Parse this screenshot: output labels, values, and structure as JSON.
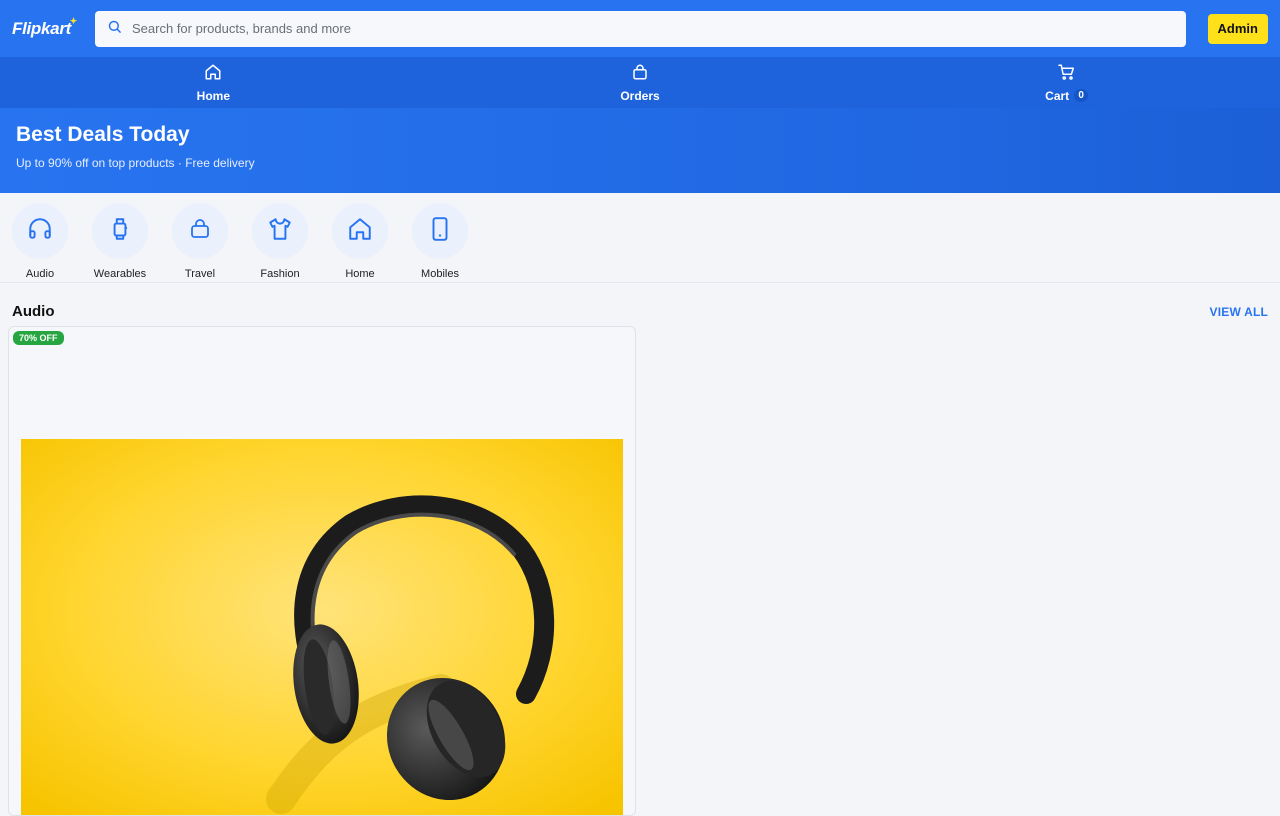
{
  "header": {
    "logo": "Flipkart",
    "search_placeholder": "Search for products, brands and more",
    "admin_label": "Admin"
  },
  "nav": {
    "home": "Home",
    "orders": "Orders",
    "cart": "Cart",
    "cart_count": "0"
  },
  "hero": {
    "title": "Best Deals Today",
    "subtitle": "Up to 90% off on top products · Free delivery"
  },
  "categories": [
    {
      "label": "Audio",
      "icon": "headphones-icon"
    },
    {
      "label": "Wearables",
      "icon": "watch-icon"
    },
    {
      "label": "Travel",
      "icon": "bag-icon"
    },
    {
      "label": "Fashion",
      "icon": "tshirt-icon"
    },
    {
      "label": "Home",
      "icon": "home-icon"
    },
    {
      "label": "Mobiles",
      "icon": "mobile-icon"
    }
  ],
  "section": {
    "title": "Audio",
    "view_all": "VIEW ALL"
  },
  "products": [
    {
      "discount": "70% OFF",
      "image": "headphones-on-yellow"
    }
  ],
  "colors": {
    "brand": "#2874f0",
    "accent": "#ffe11b",
    "discount": "#26a541"
  }
}
